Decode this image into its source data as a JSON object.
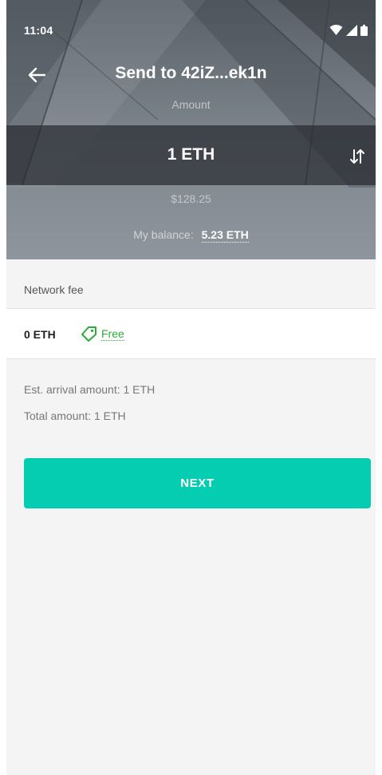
{
  "status_bar": {
    "time": "11:04",
    "icons": [
      "wifi-icon",
      "cellular-signal-icon",
      "battery-icon"
    ]
  },
  "header": {
    "back_icon": "arrow-left-icon",
    "title": "Send to 42iZ...ek1n",
    "amount_label": "Amount",
    "amount_value": "1 ETH",
    "swap_icon": "swap-vertical-icon",
    "fiat_value": "$128.25",
    "balance_label": "My balance:",
    "balance_value": "5.23 ETH"
  },
  "network_fee": {
    "label": "Network fee",
    "value": "0 ETH",
    "badge_icon": "tag-icon",
    "badge_label": "Free"
  },
  "summary": {
    "arrival_label": "Est. arrival amount:",
    "arrival_value": "1 ETH",
    "total_label": "Total amount:",
    "total_value": "1 ETH"
  },
  "next_button": {
    "label": "NEXT"
  },
  "colors": {
    "accent": "#05cdb2",
    "free_green": "#2eab37",
    "header_bg": "#7d858d",
    "page_bg": "#f4f4f4"
  }
}
